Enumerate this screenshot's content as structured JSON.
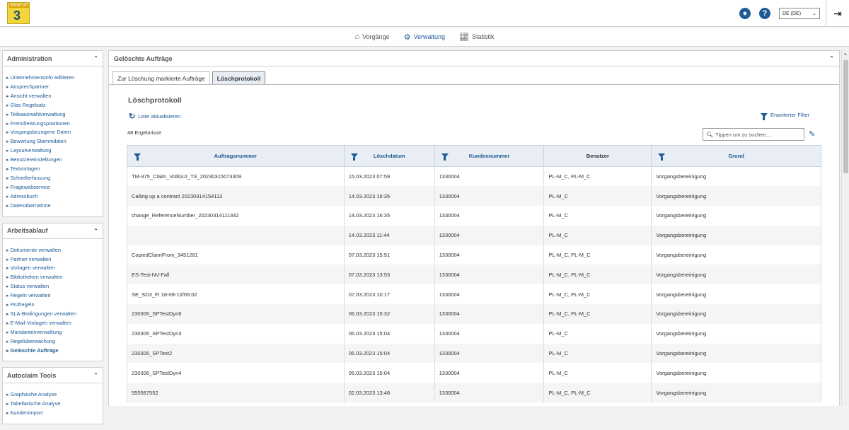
{
  "header": {
    "logo_text": "SilverDAT",
    "logo_number": "3",
    "language": "DE (DE)"
  },
  "nav": {
    "items": [
      {
        "label": "Vorgänge",
        "icon": "home-icon"
      },
      {
        "label": "Verwaltung",
        "icon": "gear-icon",
        "active": true
      },
      {
        "label": "Statistik",
        "icon": "chart-icon"
      }
    ]
  },
  "sidebar": {
    "administration": {
      "title": "Administration",
      "items": [
        "Unternehmensinfo editieren",
        "Ansprechpartner",
        "Ansicht verwalten",
        "Glas Regelsatz",
        "Teileauswahlverwaltung",
        "Fremdleistungspositionen",
        "Vorgangsbezogene Daten",
        "Bewertung Stammdaten",
        "Layoutverwaltung",
        "Benutzereinstellungen",
        "Textvorlagen",
        "Schnellerfassung",
        "Fragewebservice",
        "Adressbuch",
        "Datenübernahme"
      ]
    },
    "arbeitsablauf": {
      "title": "Arbeitsablauf",
      "items": [
        "Dokumente verwalten",
        "Partner verwalten",
        "Vorlagen verwalten",
        "Bibliotheken verwalten",
        "Status verwalten",
        "Regeln verwalten",
        "Prüfregeln",
        "SLA-Bedingungen verwalten",
        "E-Mail-Vorlagen verwalten",
        "Mandantenverwaltung",
        "Regelüberwachung",
        "Gelöschte Aufträge"
      ]
    },
    "autoclaim": {
      "title": "Autoclaim Tools",
      "items": [
        "Graphische Analyse",
        "Tabellarische Analyse",
        "Kundenimport"
      ]
    }
  },
  "main": {
    "title": "Gelöschte Aufträge",
    "tabs": [
      "Zur Löschung markierte Aufträge",
      "Löschprotokoll"
    ],
    "content_title": "Löschprotokoll",
    "refresh_label": "Liste aktualisieren",
    "filter_label": "Erweiterter Filter",
    "results": "48 Ergebnisse",
    "search_placeholder": "Tippen um zu suchen....",
    "columns": [
      "Auftragsnummer",
      "Löschdatum",
      "Kundennummer",
      "Benutzer",
      "Grund"
    ],
    "rows": [
      [
        "TM-375_Claim_VollGUI_TS_20230315073309",
        "15.03.2023 07:59",
        "1330004",
        "PL-M_C, PL-M_C",
        "Vorgangsbereinigung"
      ],
      [
        "Calling up a contract 20230314154113",
        "14.03.2023 16:35",
        "1330004",
        "PL-M_C",
        "Vorgangsbereinigung"
      ],
      [
        "change_ReferenceNumber_20230314111342",
        "14.03.2023 16:35",
        "1330004",
        "PL-M_C",
        "Vorgangsbereinigung"
      ],
      [
        "",
        "14.03.2023 11:44",
        "1330004",
        "PL-M_C",
        "Vorgangsbereinigung"
      ],
      [
        "CopiedClaimFrom_3451281",
        "07.03.2023 15:51",
        "1330004",
        "PL-M_C, PL-M_C",
        "Vorgangsbereinigung"
      ],
      [
        "ES-Test-NV-Fall",
        "07.03.2023 13:53",
        "1330004",
        "PL-M_C, PL-M_C",
        "Vorgangsbereinigung"
      ],
      [
        "SE_SD3_FI 18-08-10/06:02",
        "07.03.2023 10:17",
        "1330004",
        "PL-M_C, PL-M_C",
        "Vorgangsbereinigung"
      ],
      [
        "230306_SPTestDyn6",
        "06.03.2023 15:32",
        "1330004",
        "PL-M_C, PL-M_C",
        "Vorgangsbereinigung"
      ],
      [
        "230306_SPTestDyn3",
        "06.03.2023 15:04",
        "1330004",
        "PL-M_C",
        "Vorgangsbereinigung"
      ],
      [
        "230306_SPTest2",
        "06.03.2023 15:04",
        "1330004",
        "PL-M_C",
        "Vorgangsbereinigung"
      ],
      [
        "230306_SPTestDyn4",
        "06.03.2023 15:04",
        "1330004",
        "PL-M_C",
        "Vorgangsbereinigung"
      ],
      [
        "555587552",
        "02.03.2023 13:48",
        "1330004",
        "PL-M_C, PL-M_C",
        "Vorgangsbereinigung"
      ]
    ]
  },
  "colors": {
    "accent": "#1d5a96",
    "header_bg": "#e8eef4"
  }
}
